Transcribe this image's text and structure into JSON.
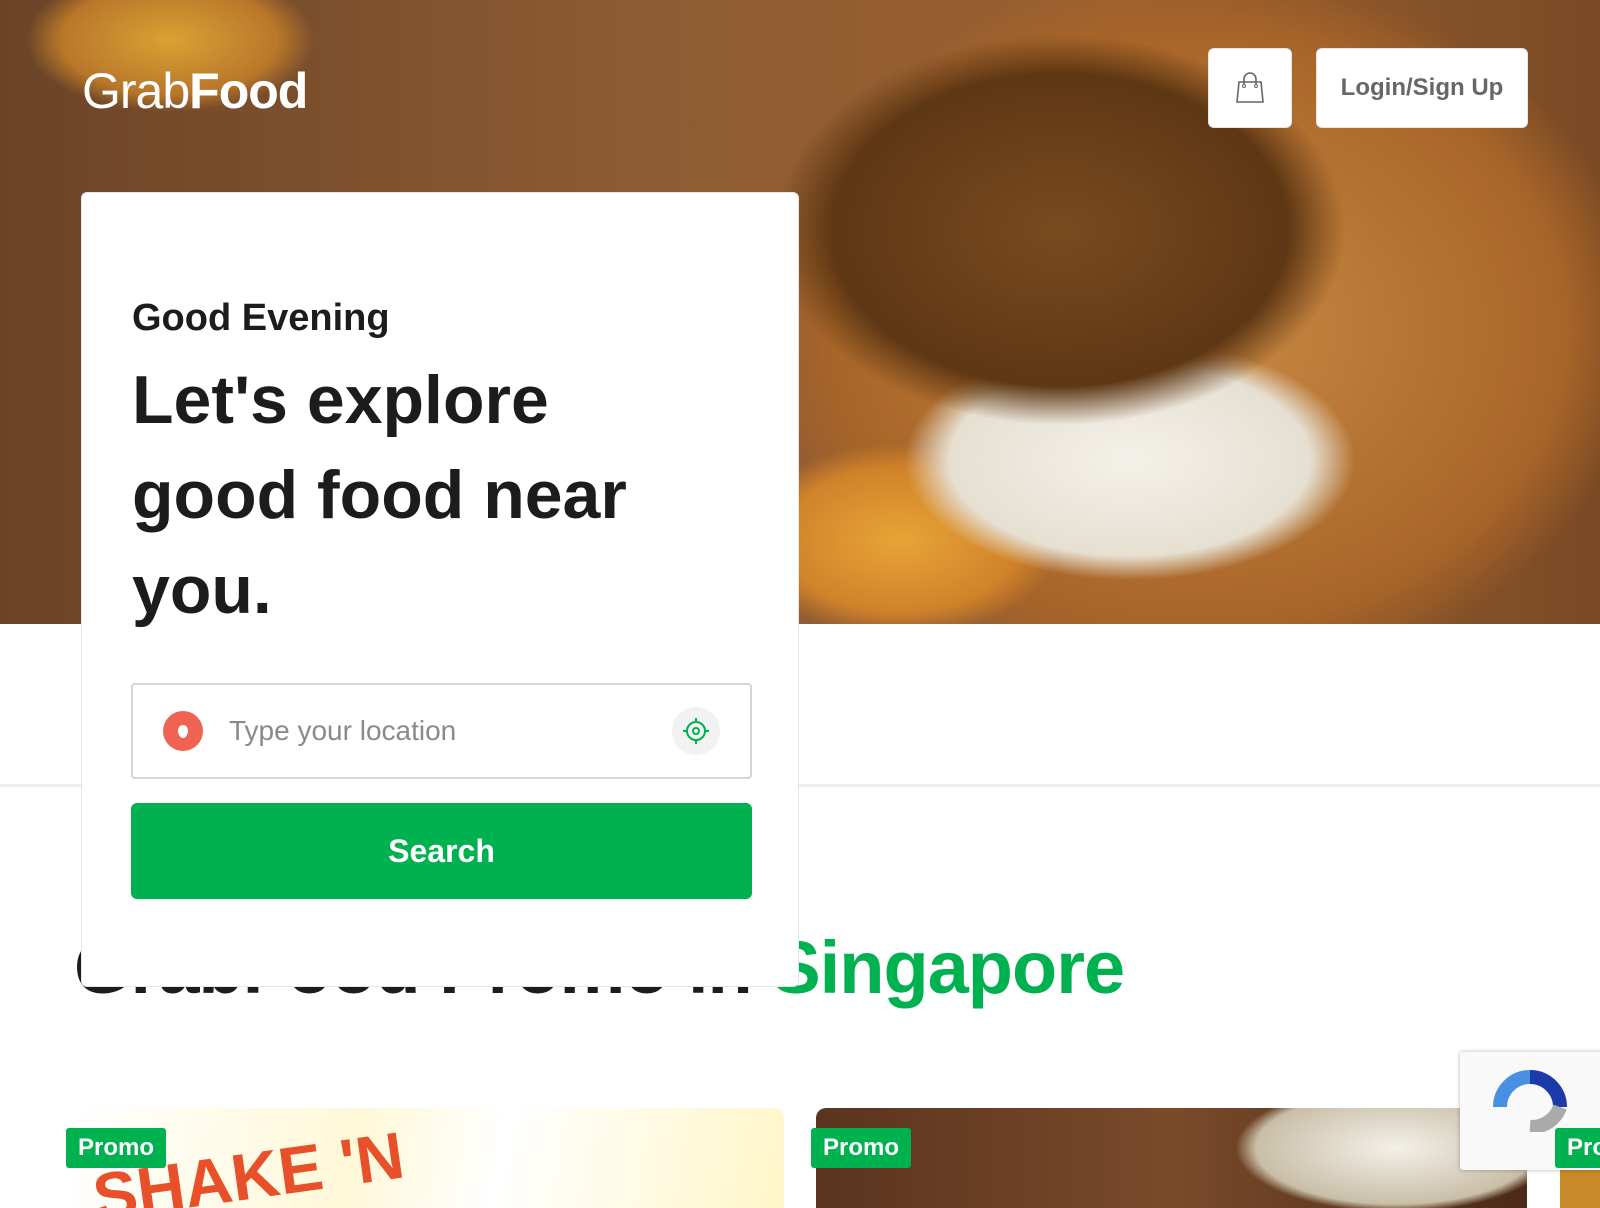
{
  "header": {
    "logo": "GrabFood",
    "logo_grab": "Grab",
    "logo_food": "Food",
    "login_label": "Login/Sign Up",
    "cart_icon": "shopping-bag-icon"
  },
  "search_card": {
    "greeting": "Good Evening",
    "headline": "Let's explore good food near you.",
    "location_placeholder": "Type your location",
    "location_value": "",
    "search_label": "Search",
    "pin_icon": "location-pin-icon",
    "gps_icon": "crosshair-icon"
  },
  "promo_section": {
    "title_prefix": "GrabFood Promo in ",
    "title_highlight": "Singapore",
    "cards": [
      {
        "badge": "Promo",
        "image_text": "SHAKE 'N"
      },
      {
        "badge": "Promo"
      },
      {
        "badge": "Promo"
      }
    ]
  },
  "colors": {
    "brand_green": "#00b14f",
    "pin_red": "#ee6352"
  }
}
